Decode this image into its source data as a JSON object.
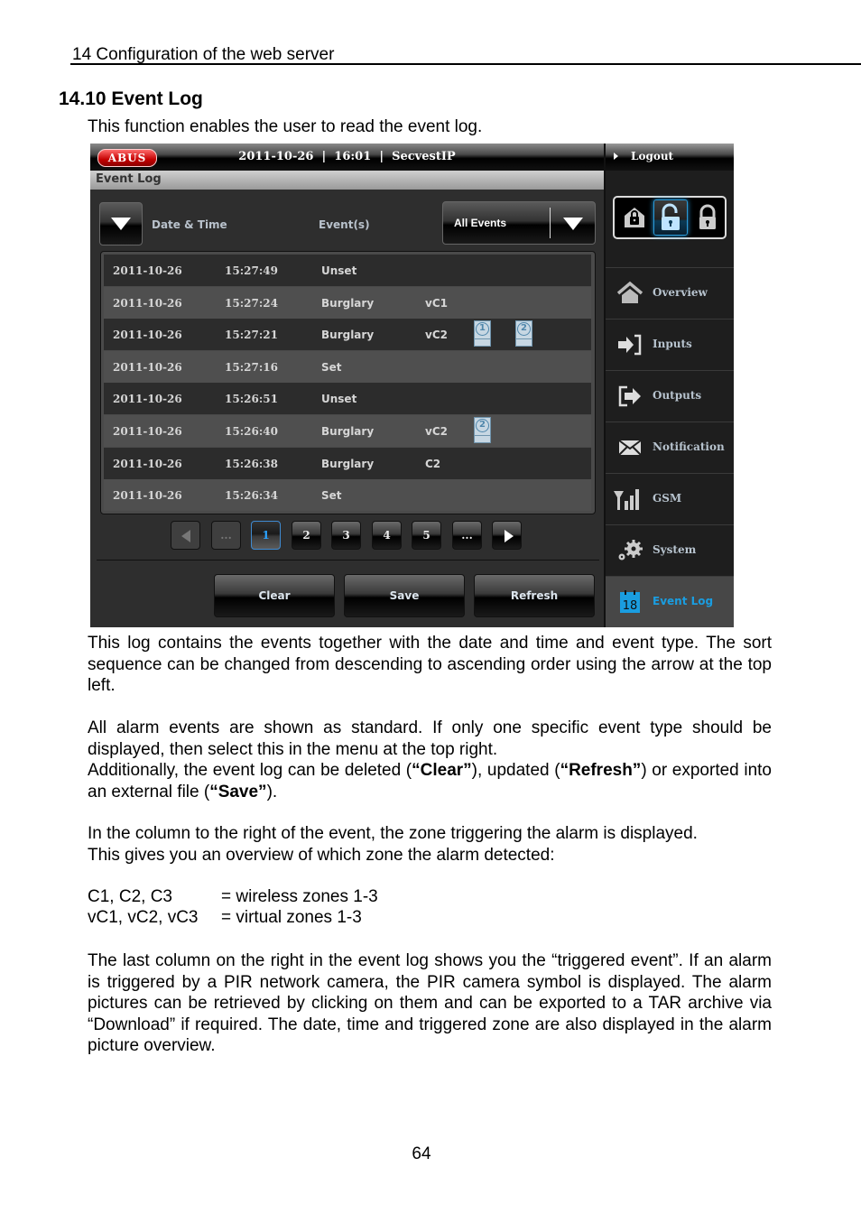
{
  "document": {
    "running_head": "14  Configuration of the web server",
    "section_title": "14.10 Event Log",
    "intro": "This function enables the user to read the event log.",
    "paragraph1": "This log contains the events together with the date and time and event type. The sort sequence can be changed from descending to ascending order using the arrow at the top left.",
    "paragraph2_a": "All alarm events are shown as standard. If only one specific event type should be displayed, then select this in the menu at the top right.",
    "paragraph2_b_parts": [
      "Additionally, the event log can be deleted (",
      "“Clear”",
      "), updated (",
      "“Refresh”",
      ") or exported into an external file (",
      "“Save”",
      ")."
    ],
    "paragraph3_a": "In the column to the right of the event, the zone triggering the alarm is displayed.",
    "paragraph3_b": "This gives you an overview of which zone the alarm detected:",
    "zones": [
      {
        "key": "C1, C2, C3",
        "value": "= wireless zones 1-3"
      },
      {
        "key": "vC1, vC2, vC3",
        "value": "= virtual zones 1-3"
      }
    ],
    "paragraph4": "The last column on the right in the event log shows you the “triggered event”. If an alarm is triggered by a PIR network camera, the PIR camera symbol is displayed. The alarm pictures can be retrieved by clicking on them and can be exported to a TAR archive via “Download” if required. The date, time and triggered zone are also displayed in the alarm picture overview.",
    "page_number": "64"
  },
  "ui": {
    "logo": "ABUS",
    "header": "2011-10-26  |  16:01  |  SecvestIP",
    "page_title": "Event Log",
    "columns": {
      "datetime": "Date & Time",
      "events": "Event(s)"
    },
    "filter": {
      "selected": "All Events",
      "icon": "chevron-down-icon"
    },
    "sort_icon": "sort-descending-icon",
    "rows": [
      {
        "date": "2011-10-26",
        "time": "15:27:49",
        "event": "Unset",
        "zone": "",
        "cameras": []
      },
      {
        "date": "2011-10-26",
        "time": "15:27:24",
        "event": "Burglary",
        "zone": "vC1",
        "cameras": []
      },
      {
        "date": "2011-10-26",
        "time": "15:27:21",
        "event": "Burglary",
        "zone": "vC2",
        "cameras": [
          "1",
          "2"
        ]
      },
      {
        "date": "2011-10-26",
        "time": "15:27:16",
        "event": "Set",
        "zone": "",
        "cameras": []
      },
      {
        "date": "2011-10-26",
        "time": "15:26:51",
        "event": "Unset",
        "zone": "",
        "cameras": []
      },
      {
        "date": "2011-10-26",
        "time": "15:26:40",
        "event": "Burglary",
        "zone": "vC2",
        "cameras": [
          "2"
        ]
      },
      {
        "date": "2011-10-26",
        "time": "15:26:38",
        "event": "Burglary",
        "zone": "C2",
        "cameras": []
      },
      {
        "date": "2011-10-26",
        "time": "15:26:34",
        "event": "Set",
        "zone": "",
        "cameras": []
      }
    ],
    "pagination": {
      "prev_ellipsis": "...",
      "pages": [
        "1",
        "2",
        "3",
        "4",
        "5"
      ],
      "next_ellipsis": "...",
      "current": "1"
    },
    "actions": {
      "clear": "Clear",
      "save": "Save",
      "refresh": "Refresh"
    },
    "sidebar": {
      "logout": "Logout",
      "lock_modes": [
        {
          "name": "partial-set",
          "icon": "house-lock-icon",
          "active": false
        },
        {
          "name": "unset",
          "icon": "unlock-icon",
          "active": true
        },
        {
          "name": "full-set",
          "icon": "lock-icon",
          "active": false
        }
      ],
      "items": [
        {
          "label": "Overview",
          "icon": "home-icon"
        },
        {
          "label": "Inputs",
          "icon": "input-icon"
        },
        {
          "label": "Outputs",
          "icon": "output-icon"
        },
        {
          "label": "Notification",
          "icon": "envelope-icon"
        },
        {
          "label": "GSM",
          "icon": "signal-icon"
        },
        {
          "label": "System",
          "icon": "gears-icon"
        },
        {
          "label": "Event Log",
          "icon": "calendar-icon",
          "active": true,
          "icon_text": "18"
        }
      ]
    },
    "colors": {
      "accent": "#1a9de0",
      "logo_red": "#c40000",
      "camera_blue": "#4f86ab"
    }
  }
}
